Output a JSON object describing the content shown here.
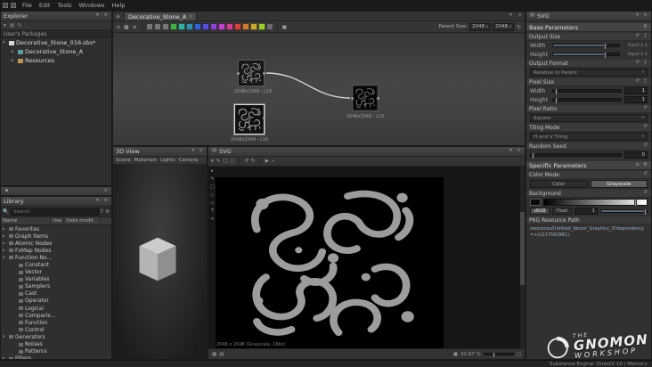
{
  "menu_bar": {
    "items": [
      "File",
      "Edit",
      "Tools",
      "Windows",
      "Help"
    ]
  },
  "explorer": {
    "title": "Explorer",
    "group_label": "User's Packages",
    "items": [
      {
        "label": "Decorative_Stone_016.sbs*"
      },
      {
        "label": "Decorative_Stone_A"
      },
      {
        "label": "Resources"
      }
    ]
  },
  "library": {
    "title": "Library",
    "search_placeholder": "Search",
    "columns": [
      "Name",
      "Use",
      "Date modif..."
    ],
    "items": [
      {
        "label": "Favorites",
        "level": 0,
        "arrow": "▸"
      },
      {
        "label": "Graph Items",
        "level": 0,
        "arrow": "▸"
      },
      {
        "label": "Atomic Nodes",
        "level": 0,
        "arrow": "▸"
      },
      {
        "label": "FxMap Nodes",
        "level": 0,
        "arrow": "▸"
      },
      {
        "label": "Function No...",
        "level": 0,
        "arrow": "▾"
      },
      {
        "label": "Constant",
        "level": 1
      },
      {
        "label": "Vector",
        "level": 1
      },
      {
        "label": "Variables",
        "level": 1
      },
      {
        "label": "Samplers",
        "level": 1
      },
      {
        "label": "Cast",
        "level": 1
      },
      {
        "label": "Operator",
        "level": 1
      },
      {
        "label": "Logical",
        "level": 1
      },
      {
        "label": "Comparis...",
        "level": 1
      },
      {
        "label": "Function",
        "level": 1
      },
      {
        "label": "Control",
        "level": 1
      },
      {
        "label": "Generators",
        "level": 0,
        "arrow": "▾"
      },
      {
        "label": "Noises",
        "level": 1
      },
      {
        "label": "Patterns",
        "level": 1
      },
      {
        "label": "Filters",
        "level": 0,
        "arrow": "▸"
      }
    ]
  },
  "graph": {
    "tab_label": "Decorative_Stone_A",
    "parent_size_label": "Parent Size:",
    "size_width": "2048",
    "size_height": "2048",
    "toolbar_colors": [
      "#777777",
      "#777777",
      "#777777",
      "#49a84f",
      "#3aa89a",
      "#3a8fa8",
      "#3a64c8",
      "#5a4fd0",
      "#8c46c8",
      "#b846c8",
      "#c8468c",
      "#c84646",
      "#c87a3a",
      "#c8a83a",
      "#9cc83a",
      "#6a6a6a"
    ],
    "nodes": [
      {
        "caption": "2048x2048 - L16"
      },
      {
        "caption": "2048x2048 - L16"
      },
      {
        "caption": "2048x2048 - L16"
      }
    ]
  },
  "viewer3d": {
    "title": "3D View",
    "menus": [
      "Scene",
      "Materials",
      "Lights",
      "Camera"
    ]
  },
  "viewer2d": {
    "title": "SVG",
    "info": "2048 x 2048 (Grayscale, 16bc)",
    "zoom": "32.67 %"
  },
  "properties": {
    "title": "SVG",
    "base_header": "Base Parameters",
    "output_size_label": "Output Size",
    "width_label": "Width",
    "height_label": "Height",
    "width_hint": "Input x 1",
    "height_hint": "Input x 1",
    "output_format_label": "Output Format",
    "output_format_value": "Relative to Parent",
    "pixel_size_label": "Pixel Size",
    "pixel_width_value": "1",
    "pixel_height_value": "1",
    "pixel_ratio_label": "Pixel Ratio",
    "pixel_ratio_value": "Square",
    "tiling_mode_label": "Tiling Mode",
    "tiling_mode_value": "H and V Tiling",
    "random_seed_label": "Random Seed",
    "random_seed_value": "0",
    "specific_header": "Specific Parameters",
    "color_mode_label": "Color Mode",
    "color_option": "Color",
    "grayscale_option": "Grayscale",
    "background_label": "Background",
    "srgb_label": "sRGB",
    "float_label": "Float",
    "background_value": "1",
    "pkg_path_label": "PKG Resource Path",
    "pkg_path_value": "resources/Untitled_Vector_Graphics_3?dependency=+(1217563961)"
  },
  "status_bar": {
    "engine_info": "Substance Engine: DirectX 10  |  Memory:"
  },
  "watermark": {
    "line1": "THE",
    "line2": "GNOMON",
    "line3": "WORKSHOP"
  }
}
